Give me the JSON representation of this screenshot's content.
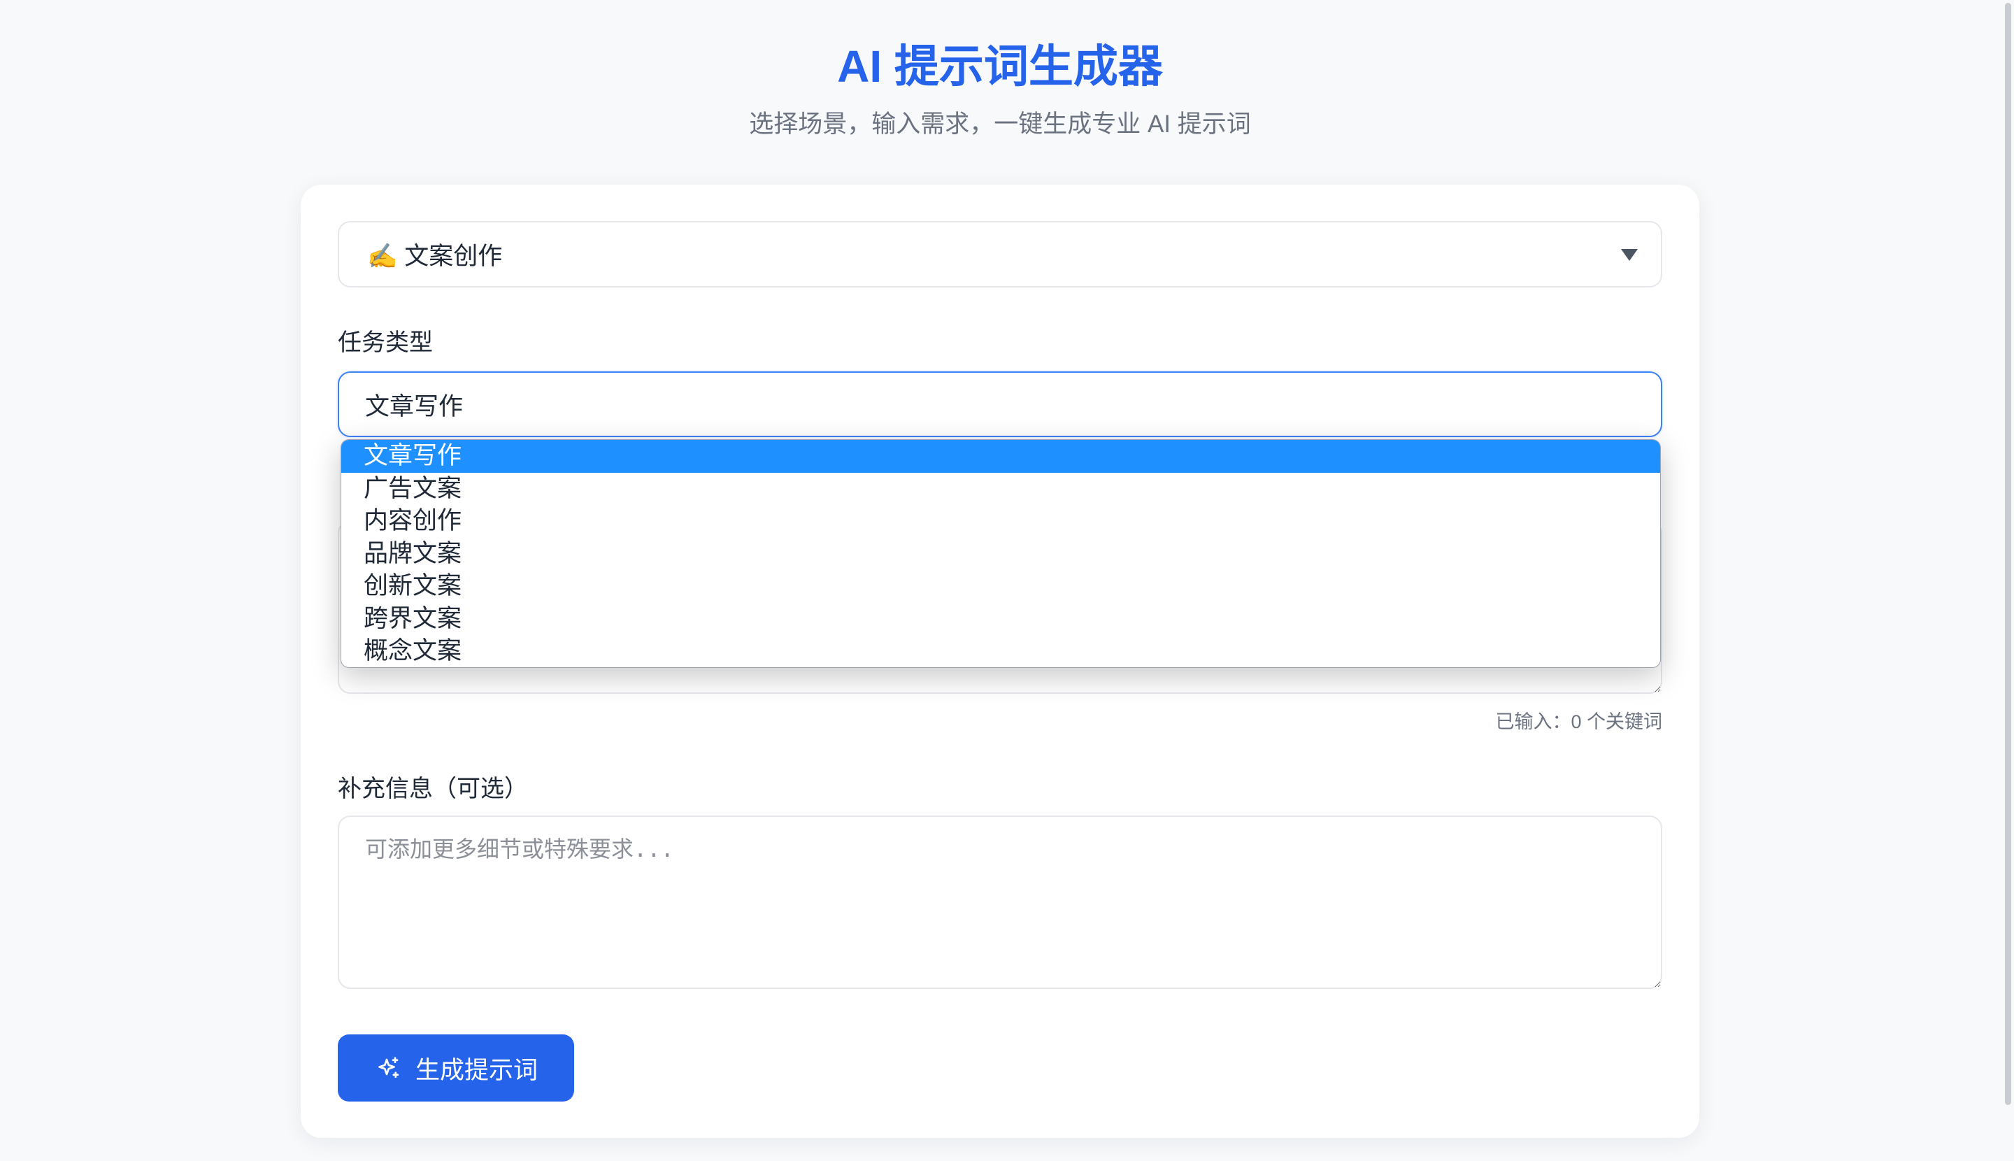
{
  "page": {
    "title": "AI 提示词生成器",
    "subtitle": "选择场景，输入需求，一键生成专业 AI 提示词"
  },
  "scene_select": {
    "value": "✍️ 文案创作",
    "arrow_icon": "caret-down-icon"
  },
  "task_type": {
    "label": "任务类型",
    "value": "文章写作",
    "options": [
      "文章写作",
      "广告文案",
      "内容创作",
      "品牌文案",
      "创新文案",
      "跨界文案",
      "概念文案"
    ],
    "highlighted_index": 0
  },
  "keywords": {
    "count_text": "已输入：0 个关键词"
  },
  "extra_info": {
    "label": "补充信息（可选）",
    "placeholder": "可添加更多细节或特殊要求..."
  },
  "generate_button": {
    "label": "生成提示词",
    "icon": "sparkles-icon"
  },
  "colors": {
    "accent": "#2563eb",
    "option_highlight": "#1e90ff",
    "focus_border": "#3b82f6"
  }
}
